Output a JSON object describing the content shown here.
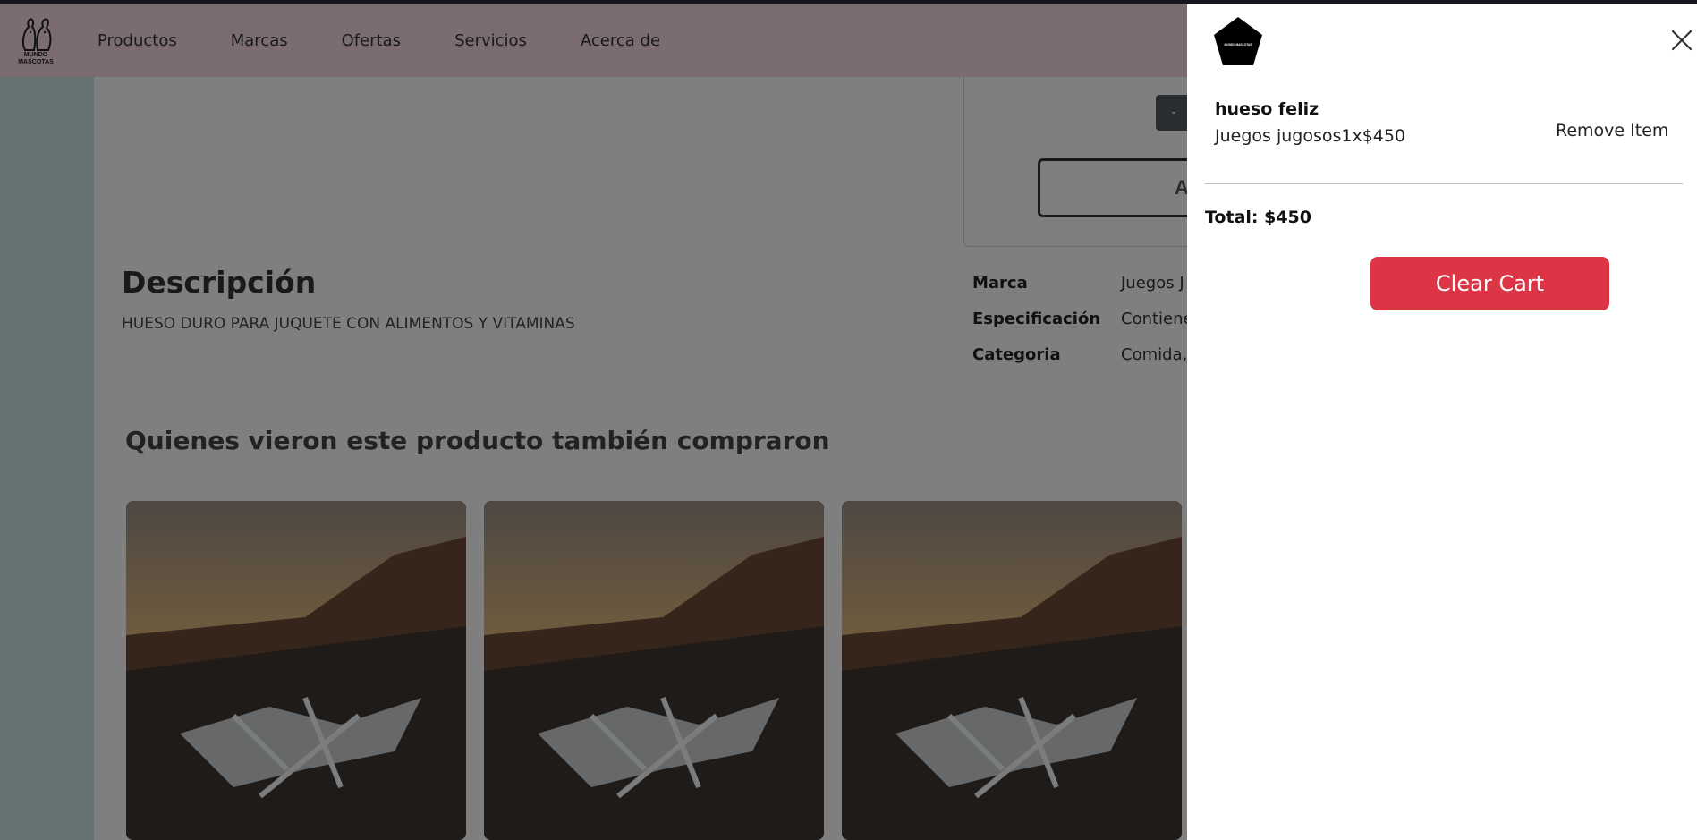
{
  "navbar": {
    "logo_text_line1": "MUNDO",
    "logo_text_line2": "MASCOTAS",
    "links": [
      "Productos",
      "Marcas",
      "Ofertas",
      "Servicios",
      "Acerca de"
    ]
  },
  "product": {
    "qty_minus_label": "-",
    "add_button_label": "A",
    "description_title": "Descripción",
    "description_text": "HUESO DURO PARA JUQUETE CON ALIMENTOS Y VITAMINAS",
    "specs": [
      {
        "key": "Marca",
        "value": "Juegos J"
      },
      {
        "key": "Especificación",
        "value": "Contiene"
      },
      {
        "key": "Categoria",
        "value": "Comida,"
      }
    ]
  },
  "related": {
    "title": "Quienes vieron este producto también compraron",
    "cards": [
      {
        "image": "road-landscape-image"
      },
      {
        "image": "road-landscape-image"
      },
      {
        "image": "road-landscape-image"
      }
    ]
  },
  "cart": {
    "logo_text": "MUNDO MASCOTAS",
    "item_name": "hueso feliz",
    "item_detail": "Juegos jugosos1x$450",
    "remove_label": "Remove Item",
    "total": "Total: $450",
    "clear_label": "Clear Cart",
    "close_icon": "close-icon",
    "accent_color": "#dc3545"
  }
}
